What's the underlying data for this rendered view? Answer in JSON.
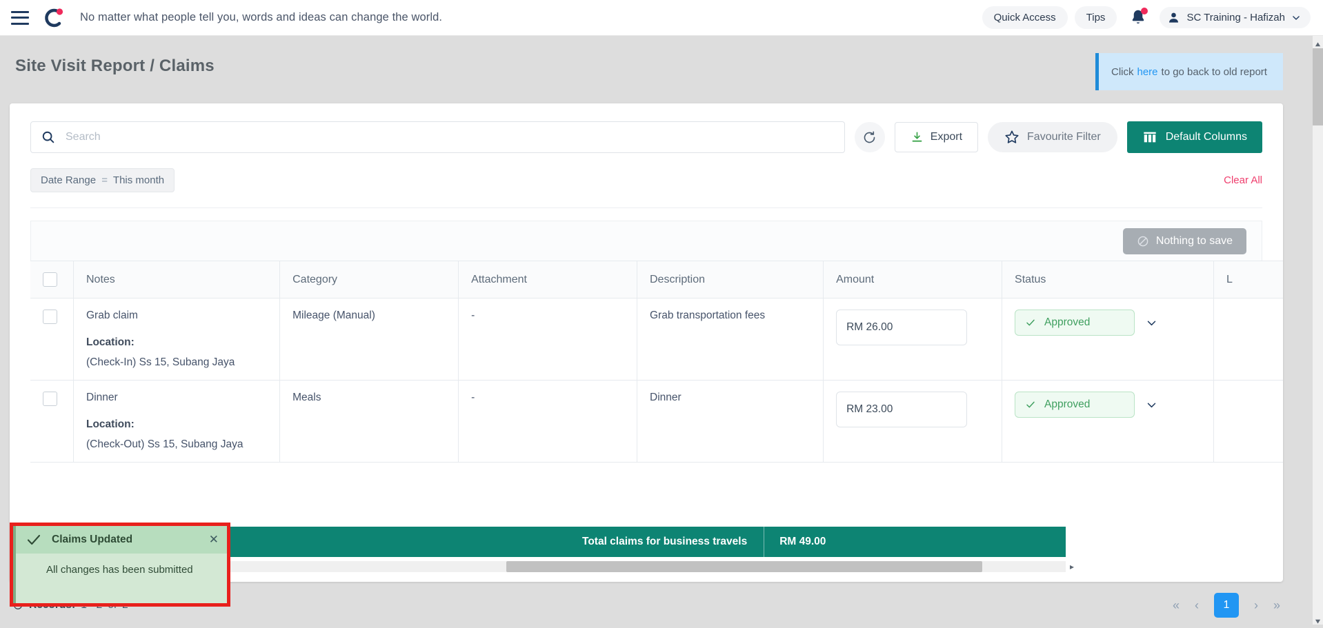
{
  "topbar": {
    "menu_icon": "hamburger-icon",
    "logo_icon": "brand-logo",
    "quote": "No matter what people tell you, words and ideas can change the world.",
    "quick_access": "Quick Access",
    "tips": "Tips",
    "notification_icon": "bell-icon",
    "account_name": "SC Training - Hafizah"
  },
  "page": {
    "title": "Site Visit Report / Claims",
    "banner": {
      "prefix": "Click",
      "link": "here",
      "suffix": "to go back to old report"
    }
  },
  "toolbar": {
    "search_placeholder": "Search",
    "search_value": "",
    "search_icon": "search-icon",
    "refresh_icon": "refresh-icon",
    "export_label": "Export",
    "export_icon": "download-icon",
    "favourite_filter_label": "Favourite Filter",
    "favourite_filter_icon": "star-icon",
    "default_columns_label": "Default Columns",
    "default_columns_icon": "columns-icon"
  },
  "filters": {
    "chips": [
      {
        "field": "Date Range",
        "operator": "=",
        "value": "This month"
      }
    ],
    "clear_all": "Clear All"
  },
  "save_bar": {
    "save_label": "Nothing to save",
    "save_icon": "no-entry-icon",
    "disabled": true
  },
  "table": {
    "columns": [
      "Notes",
      "Category",
      "Attachment",
      "Description",
      "Amount",
      "Status",
      "L"
    ],
    "location_label": "Location:",
    "rows": [
      {
        "notes": "Grab claim",
        "location": "(Check-In) Ss 15, Subang Jaya",
        "category": "Mileage (Manual)",
        "attachment": "-",
        "description": "Grab transportation fees",
        "amount": "RM 26.00",
        "status": "Approved"
      },
      {
        "notes": "Dinner",
        "location": "(Check-Out) Ss 15, Subang Jaya",
        "category": "Meals",
        "attachment": "-",
        "description": "Dinner",
        "amount": "RM 23.00",
        "status": "Approved"
      }
    ],
    "total_label": "Total claims for business travels",
    "total_value": "RM 49.00"
  },
  "toast": {
    "title": "Claims Updated",
    "message": "All changes has been submitted",
    "check_icon": "check-icon",
    "close_icon": "close-icon"
  },
  "footer": {
    "refresh_icon": "refresh-icon",
    "records_label": "Records:",
    "records_range": "1 - 2",
    "records_of": "of",
    "records_total": "2",
    "pager": {
      "first": "«",
      "prev": "‹",
      "current": "1",
      "next": "›",
      "last": "»"
    }
  },
  "colors": {
    "teal": "#0d8473",
    "accent_pink": "#ef3e6d",
    "blue": "#2196f3",
    "green": "#3f9f5f",
    "navy": "#1f3a5f"
  }
}
